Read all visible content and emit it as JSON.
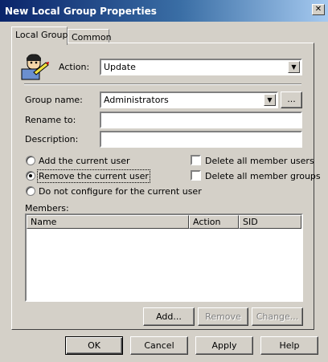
{
  "window": {
    "title": "New Local Group Properties",
    "close_glyph": "✕"
  },
  "tabs": [
    {
      "label": "Local Group",
      "active": true
    },
    {
      "label": "Common",
      "active": false
    }
  ],
  "form": {
    "action_label": "Action:",
    "action_value": "Update",
    "group_name_label": "Group name:",
    "group_name_value": "Administrators",
    "browse_label": "...",
    "rename_label": "Rename to:",
    "rename_value": "",
    "description_label": "Description:",
    "description_value": ""
  },
  "user_options": [
    {
      "label": "Add the current user",
      "checked": false
    },
    {
      "label": "Remove the current user",
      "checked": true
    },
    {
      "label": "Do not configure for the current user",
      "checked": false
    }
  ],
  "checkboxes": [
    {
      "label": "Delete all member users",
      "checked": false
    },
    {
      "label": "Delete all member groups",
      "checked": false
    }
  ],
  "members": {
    "label": "Members:",
    "columns": [
      "Name",
      "Action",
      "SID"
    ],
    "rows": []
  },
  "member_buttons": {
    "add": "Add...",
    "remove": "Remove",
    "change": "Change..."
  },
  "footer_buttons": {
    "ok": "OK",
    "cancel": "Cancel",
    "apply": "Apply",
    "help": "Help"
  },
  "colors": {
    "title_start": "#0a246a",
    "title_end": "#a6caf0",
    "face": "#d4d0c8"
  }
}
